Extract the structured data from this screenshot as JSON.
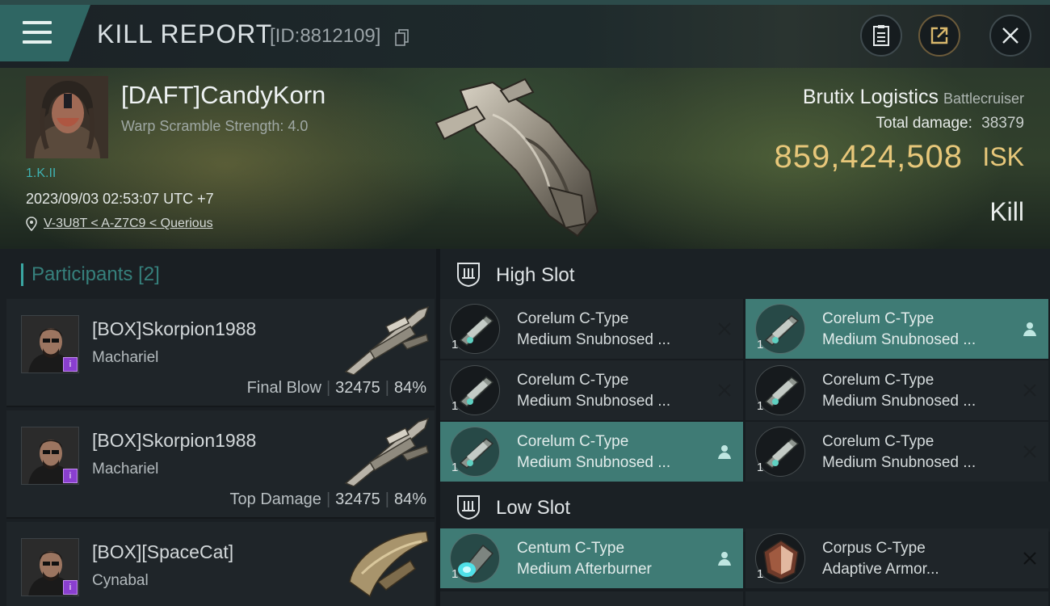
{
  "header": {
    "title": "KILL REPORT",
    "kill_id": "[ID:8812109]"
  },
  "victim": {
    "name": "[DAFT]CandyKorn",
    "warp_scramble": "Warp Scramble Strength: 4.0",
    "security_status": "1.K.II",
    "timestamp": "2023/09/03 02:53:07 UTC +7",
    "location": "V-3U8T < A-Z7C9 < Querious",
    "ship_name": "Brutix Logistics",
    "ship_class": "Battlecruiser",
    "total_damage_label": "Total damage:",
    "total_damage": "38379",
    "isk_value": "859,424,508",
    "isk_unit": "ISK",
    "result": "Kill"
  },
  "participants": {
    "label": "Participants",
    "count": "[2]",
    "items": [
      {
        "name": "[BOX]Skorpion1988",
        "ship": "Machariel",
        "stat_label": "Final Blow",
        "damage": "32475",
        "percent": "84%",
        "badge": "i"
      },
      {
        "name": "[BOX]Skorpion1988",
        "ship": "Machariel",
        "stat_label": "Top Damage",
        "damage": "32475",
        "percent": "84%",
        "badge": "i"
      },
      {
        "name": "[BOX][SpaceCat]",
        "ship": "Cynabal",
        "badge": "i"
      }
    ]
  },
  "fitting": {
    "high_slot": {
      "title": "High Slot",
      "modules": [
        {
          "line1": "Corelum C-Type",
          "line2": "Medium Snubnosed ...",
          "qty": "1",
          "state": "destroyed"
        },
        {
          "line1": "Corelum C-Type",
          "line2": "Medium Snubnosed ...",
          "qty": "1",
          "state": "dropped"
        },
        {
          "line1": "Corelum C-Type",
          "line2": "Medium Snubnosed ...",
          "qty": "1",
          "state": "destroyed"
        },
        {
          "line1": "Corelum C-Type",
          "line2": "Medium Snubnosed ...",
          "qty": "1",
          "state": "destroyed"
        },
        {
          "line1": "Corelum C-Type",
          "line2": "Medium Snubnosed ...",
          "qty": "1",
          "state": "dropped"
        },
        {
          "line1": "Corelum C-Type",
          "line2": "Medium Snubnosed ...",
          "qty": "1",
          "state": "destroyed"
        }
      ]
    },
    "low_slot": {
      "title": "Low Slot",
      "modules": [
        {
          "line1": "Centum C-Type",
          "line2": "Medium Afterburner",
          "qty": "1",
          "state": "dropped"
        },
        {
          "line1": "Corpus C-Type",
          "line2": "Adaptive Armor...",
          "qty": "1",
          "state": "destroyed"
        }
      ]
    }
  },
  "colors": {
    "accent_teal": "#3f7b75",
    "isk_gold": "#e7c77a",
    "participants_teal": "#36807c"
  }
}
